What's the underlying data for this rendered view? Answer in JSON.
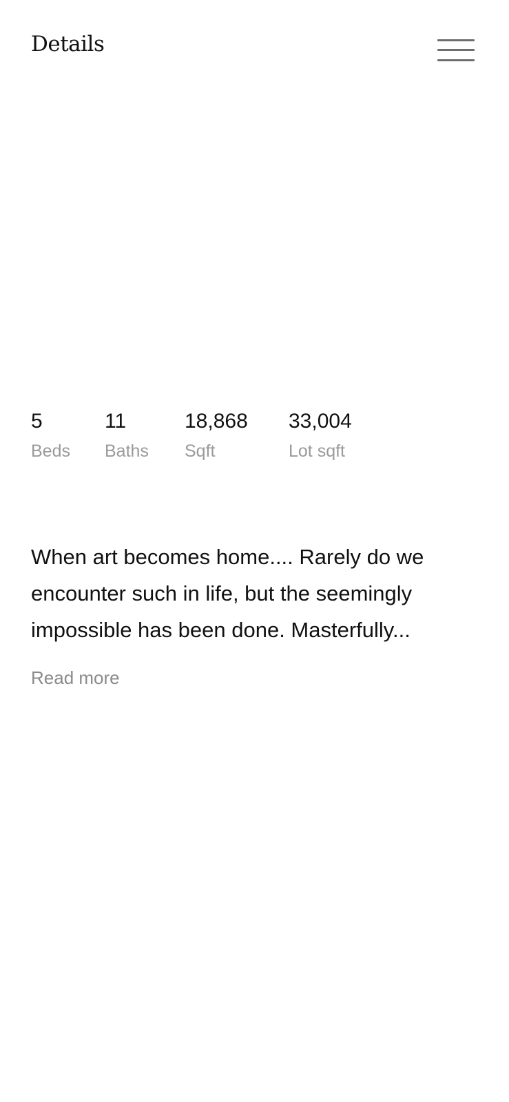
{
  "header": {
    "title": "Details",
    "menu_icon": "hamburger-menu-icon"
  },
  "stats": {
    "beds": {
      "value": "5",
      "label": "Beds"
    },
    "baths": {
      "value": "11",
      "label": "Baths"
    },
    "sqft": {
      "value": "18,868",
      "label": "Sqft"
    },
    "lot_sqft": {
      "value": "33,004",
      "label": "Lot sqft"
    }
  },
  "description": {
    "text": "When art becomes home.... Rarely do we encounter such in life, but the seemingly impossible has been done. Masterfully...",
    "read_more_label": "Read more"
  },
  "colors": {
    "text_primary": "#111111",
    "text_secondary": "#9a9a9a",
    "link_muted": "#8a8a8a",
    "menu_icon": "#6e6e6e",
    "background": "#ffffff"
  }
}
